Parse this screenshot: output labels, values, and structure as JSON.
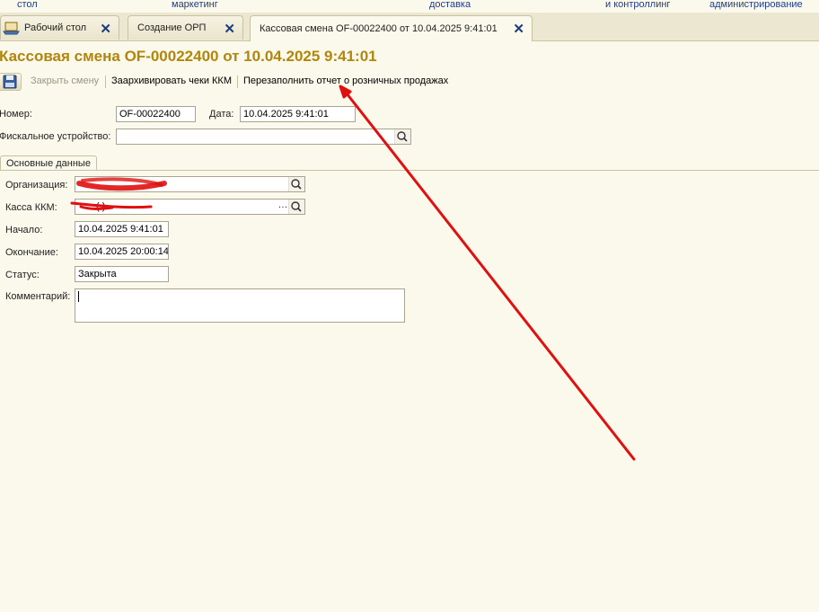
{
  "topnav": [
    "стол",
    "маркетинг",
    "доставка",
    "и контроллинг",
    "администрирование"
  ],
  "tabs": [
    {
      "label": "Рабочий стол"
    },
    {
      "label": "Создание ОРП"
    },
    {
      "label": "Кассовая смена OF-00022400 от 10.04.2025 9:41:01"
    }
  ],
  "page_title": "Кассовая смена OF-00022400 от 10.04.2025 9:41:01",
  "toolbar": {
    "close_shift": "Закрыть смену",
    "archive_checks": "Заархивировать чеки ККМ",
    "refill_report": "Перезаполнить отчет о розничных продажах"
  },
  "form": {
    "number_label": "Номер:",
    "number_value": "OF-00022400",
    "date_label": "Дата:",
    "date_value": "10.04.2025  9:41:01",
    "fiscal_label": "Фискальное устройство:",
    "fiscal_value": ""
  },
  "subtab": "Основные данные",
  "details": {
    "org_label": "Организация:",
    "kassa_label": "Касса ККМ:",
    "kassa_visible": "(         )",
    "start_label": "Начало:",
    "start_value": "10.04.2025  9:41:01",
    "end_label": "Окончание:",
    "end_value": "10.04.2025 20:00:14",
    "status_label": "Статус:",
    "status_value": "Закрыта",
    "comment_label": "Комментарий:",
    "comment_value": ""
  },
  "colors": {
    "title": "#b2860a",
    "nav_link": "#1f3d8a",
    "annotation": "#e01010"
  }
}
